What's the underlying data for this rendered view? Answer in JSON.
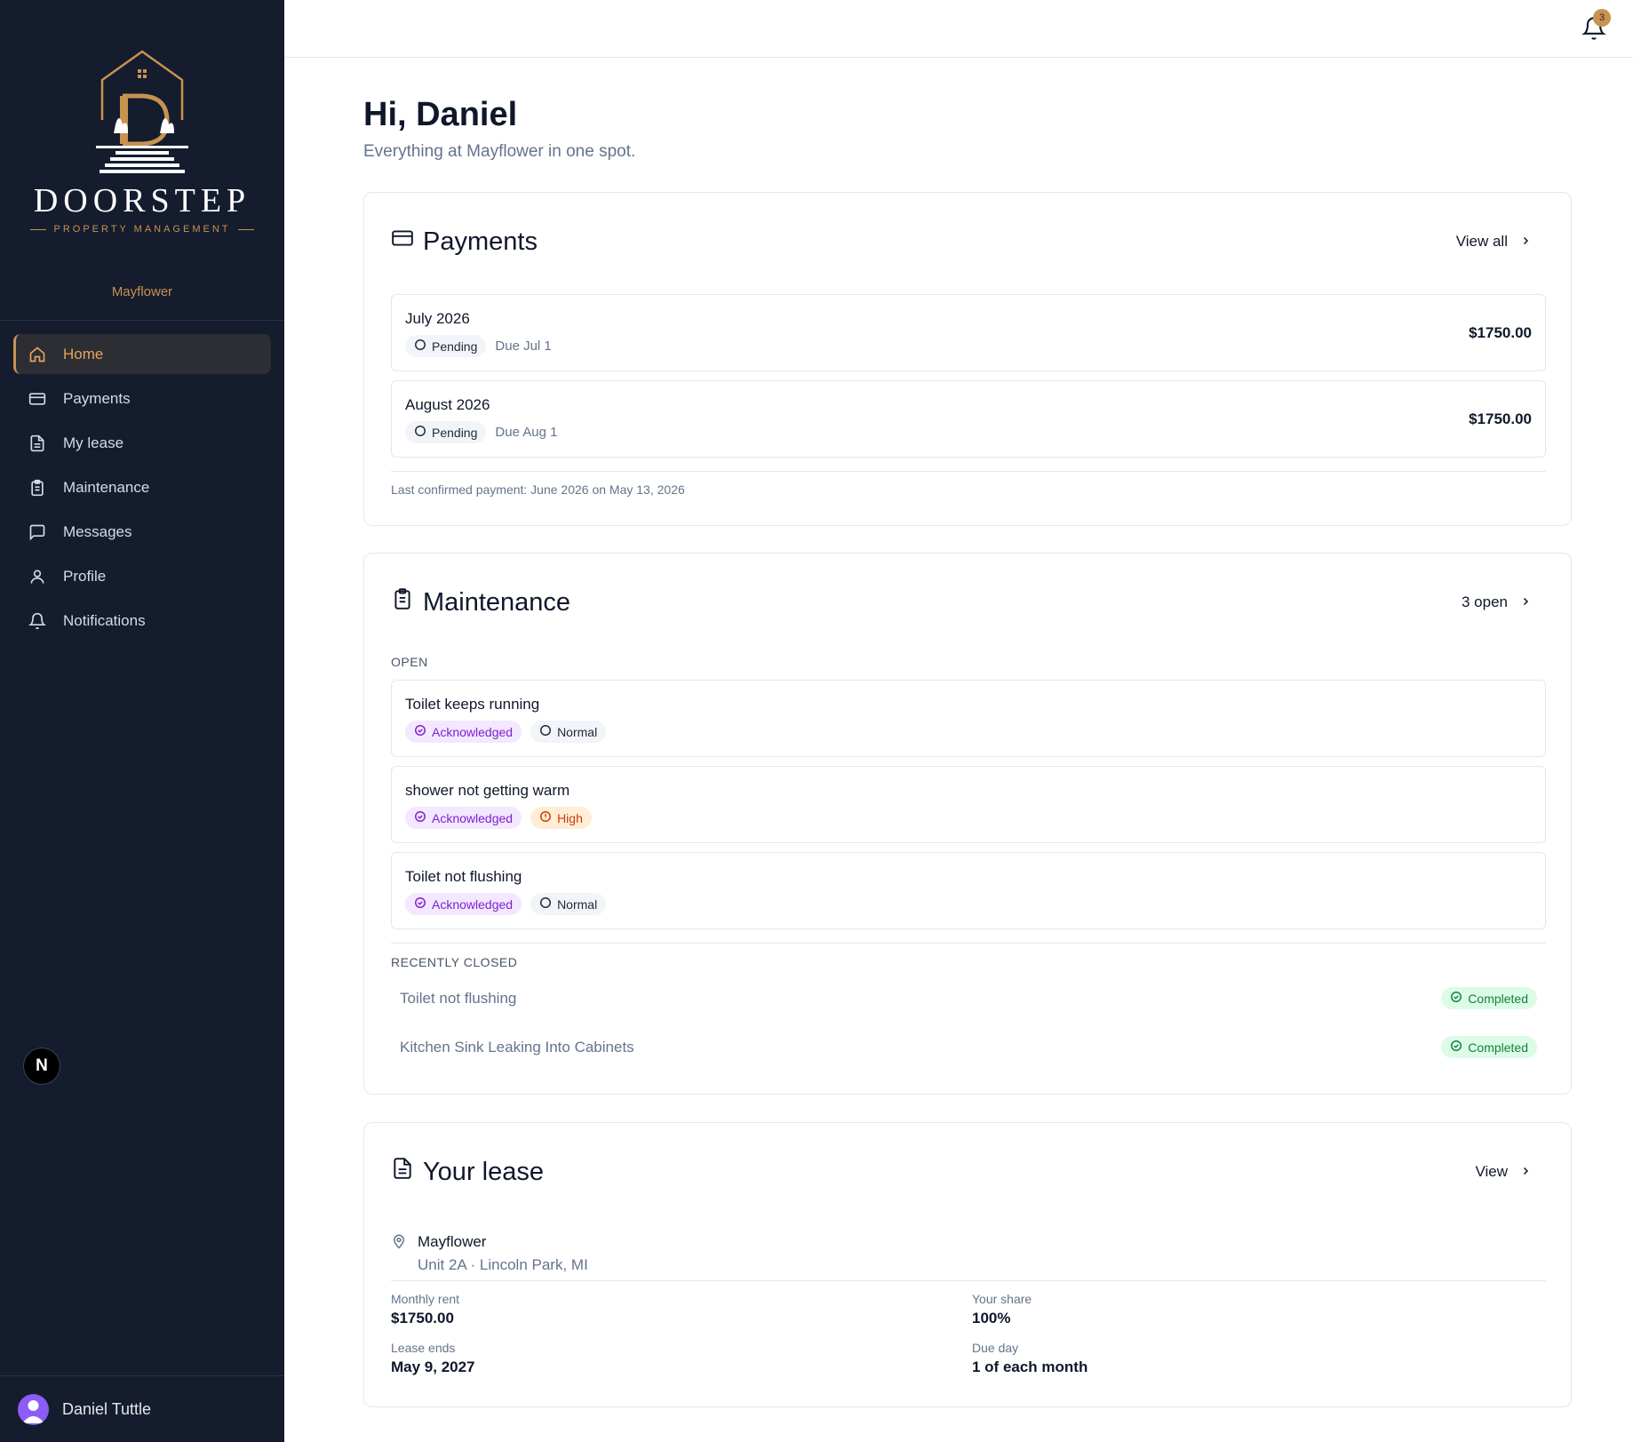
{
  "brand": {
    "word": "DOORSTEP",
    "sub": "PROPERTY MANAGEMENT"
  },
  "sidebar": {
    "property": "Mayflower",
    "items": [
      {
        "label": "Home",
        "icon": "home-icon",
        "active": true
      },
      {
        "label": "Payments",
        "icon": "credit-card-icon"
      },
      {
        "label": "My lease",
        "icon": "document-icon"
      },
      {
        "label": "Maintenance",
        "icon": "clipboard-icon"
      },
      {
        "label": "Messages",
        "icon": "message-icon"
      },
      {
        "label": "Profile",
        "icon": "user-icon"
      },
      {
        "label": "Notifications",
        "icon": "bell-icon"
      }
    ],
    "badge": "N",
    "user": "Daniel Tuttle"
  },
  "topbar": {
    "notification_count": "3"
  },
  "greeting": {
    "title": "Hi, Daniel",
    "subtitle": "Everything at Mayflower in one spot."
  },
  "payments": {
    "title": "Payments",
    "link": "View all",
    "rows": [
      {
        "title": "July 2026",
        "status": "Pending",
        "due": "Due Jul 1",
        "amount": "$1750.00"
      },
      {
        "title": "August 2026",
        "status": "Pending",
        "due": "Due Aug 1",
        "amount": "$1750.00"
      }
    ],
    "note": "Last confirmed payment: June 2026 on May 13, 2026"
  },
  "maintenance": {
    "title": "Maintenance",
    "link": "3 open",
    "open_label": "OPEN",
    "open": [
      {
        "title": "Toilet keeps running",
        "status": "Acknowledged",
        "priority": "Normal"
      },
      {
        "title": "shower not getting warm",
        "status": "Acknowledged",
        "priority": "High"
      },
      {
        "title": "Toilet not flushing",
        "status": "Acknowledged",
        "priority": "Normal"
      }
    ],
    "closed_label": "RECENTLY CLOSED",
    "closed": [
      {
        "title": "Toilet not flushing",
        "status": "Completed"
      },
      {
        "title": "Kitchen Sink Leaking Into Cabinets",
        "status": "Completed"
      }
    ]
  },
  "lease": {
    "title": "Your lease",
    "link": "View",
    "property": "Mayflower",
    "address": "Unit 2A · Lincoln Park, MI",
    "monthly_rent_label": "Monthly rent",
    "monthly_rent": "$1750.00",
    "share_label": "Your share",
    "share": "100%",
    "ends_label": "Lease ends",
    "ends": "May 9, 2027",
    "due_label": "Due day",
    "due": "1 of each month"
  },
  "colors": {
    "sidebar_bg": "#141c2e",
    "accent": "#c8924f"
  }
}
